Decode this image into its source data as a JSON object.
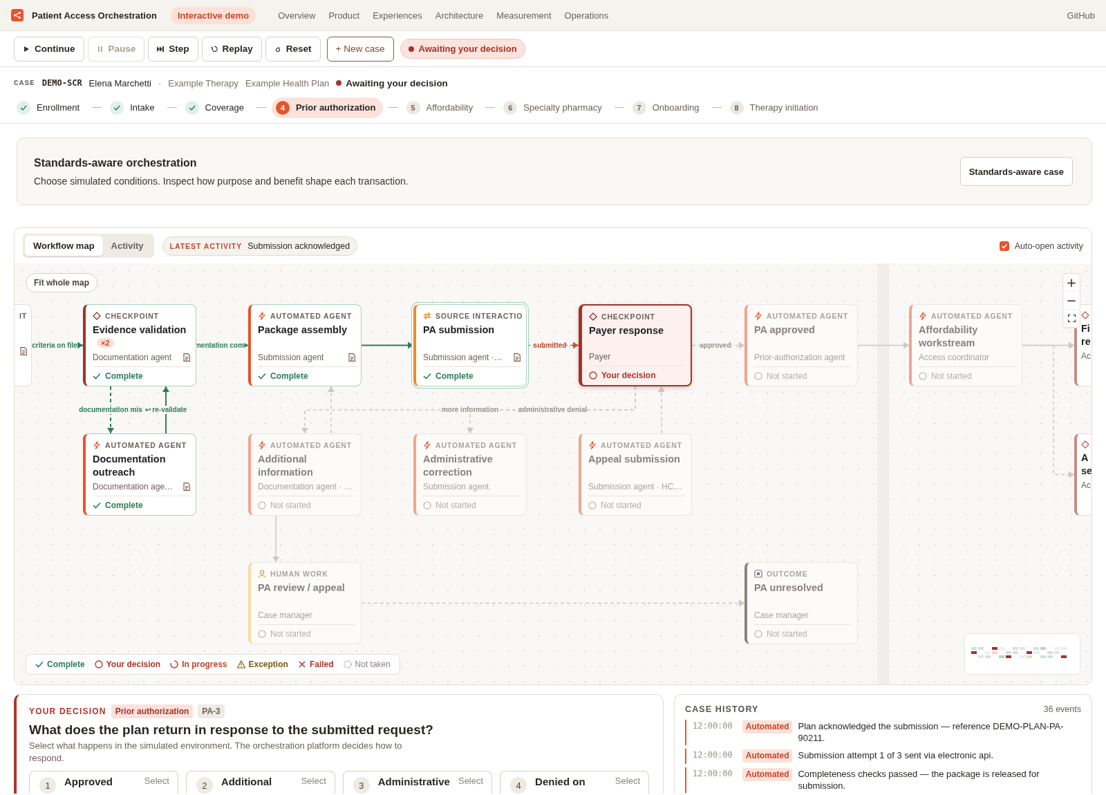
{
  "nav": {
    "title": "Patient Access Orchestration",
    "badge": "Interactive demo",
    "links": [
      "Overview",
      "Product",
      "Experiences",
      "Architecture",
      "Measurement",
      "Operations"
    ],
    "github": "GitHub"
  },
  "toolbar": {
    "buttons": [
      {
        "kind": "play",
        "label": "Continue",
        "disabled": false
      },
      {
        "kind": "pause",
        "label": "Pause",
        "disabled": true
      },
      {
        "kind": "step",
        "label": "Step",
        "disabled": false
      },
      {
        "kind": "replay",
        "label": "Replay",
        "disabled": false
      },
      {
        "kind": "reset",
        "label": "Reset",
        "disabled": false
      },
      {
        "kind": "new",
        "label": "+ New case",
        "disabled": false
      }
    ],
    "status": "Awaiting your decision"
  },
  "case": {
    "label": "CASE",
    "id": "DEMO-SCR",
    "patient": "Elena Marchetti",
    "separator": "·",
    "therapy": "Example Therapy",
    "plan": "Example Health Plan",
    "status": "Awaiting your decision"
  },
  "steps": [
    {
      "label": "Enrollment",
      "completed": true,
      "selected": false
    },
    {
      "label": "Intake",
      "completed": true,
      "selected": false
    },
    {
      "label": "Coverage",
      "completed": true,
      "selected": false
    },
    {
      "number": "4",
      "label": "Prior authorization",
      "completed": false,
      "selected": true
    },
    {
      "number": "5",
      "label": "Affordability",
      "completed": false,
      "selected": false
    },
    {
      "number": "6",
      "label": "Specialty pharmacy",
      "completed": false,
      "selected": false
    },
    {
      "number": "7",
      "label": "Onboarding",
      "completed": false,
      "selected": false
    },
    {
      "number": "8",
      "label": "Therapy initiation",
      "completed": false,
      "selected": false
    }
  ],
  "banner": {
    "title": "Standards-aware orchestration",
    "text": "Choose simulated conditions. Inspect how purpose and benefit shape each transaction.",
    "button": "Standards-aware case"
  },
  "map": {
    "tabs": [
      {
        "label": "Workflow map",
        "selected": true
      },
      {
        "label": "Activity",
        "selected": false
      }
    ],
    "latest": {
      "label": "LATEST ACTIVITY",
      "text": "Submission acknowledged"
    },
    "auto_open": {
      "label": "Auto-open activity",
      "checked": true
    },
    "fit_button": "Fit whole map",
    "zoom_controls": [
      "+",
      "−"
    ],
    "nodes": [
      {
        "kind": "partial",
        "label": "IT",
        "doc": true
      },
      {
        "kind": "checkpoint",
        "label": "CHECKPOINT",
        "title": "Evidence validation",
        "badge": "×2",
        "role": "Documentation agent",
        "doc": true,
        "complete": true,
        "awaiting_decision": false,
        "status_text": "Complete",
        "selected": false,
        "focused": false
      },
      {
        "kind": "agent",
        "label": "AUTOMATED AGENT",
        "title": "Package assembly",
        "role": "Submission agent",
        "doc": true,
        "complete": true,
        "awaiting_decision": false,
        "status_text": "Complete",
        "selected": false,
        "focused": false
      },
      {
        "kind": "source",
        "label": "SOURCE INTERACTIO",
        "title": "PA submission",
        "role": "Submission agent ·…",
        "doc": true,
        "complete": true,
        "awaiting_decision": false,
        "status_text": "Complete",
        "selected": false,
        "focused": true
      },
      {
        "kind": "checkpoint",
        "label": "CHECKPOINT",
        "title": "Payer response",
        "role": "Payer",
        "doc": false,
        "complete": false,
        "awaiting_decision": true,
        "status_text": "Your decision",
        "selected": true,
        "focused": false
      },
      {
        "kind": "agent",
        "label": "AUTOMATED AGENT",
        "title": "PA approved",
        "role": "Prior-authorization agent",
        "doc": false,
        "complete": false,
        "awaiting_decision": false,
        "status_text": "Not started",
        "selected": false,
        "focused": false
      },
      {
        "kind": "agent",
        "label": "AUTOMATED AGENT",
        "title": "Affordability workstream",
        "role": "Access coordinator",
        "doc": false,
        "complete": false,
        "awaiting_decision": false,
        "status_text": "Not started",
        "selected": false,
        "focused": false
      },
      {
        "kind": "partial",
        "title": "Fi re",
        "role": "Ac"
      },
      {
        "kind": "agent",
        "label": "AUTOMATED AGENT",
        "title": "Documentation outreach",
        "role": "Documentation age…",
        "doc": true,
        "complete": true,
        "awaiting_decision": false,
        "status_text": "Complete",
        "selected": false,
        "focused": false
      },
      {
        "kind": "agent",
        "label": "AUTOMATED AGENT",
        "title": "Additional information",
        "role": "Documentation agent · …",
        "doc": false,
        "complete": false,
        "awaiting_decision": false,
        "status_text": "Not started",
        "selected": false,
        "focused": false
      },
      {
        "kind": "agent",
        "label": "AUTOMATED AGENT",
        "title": "Administrative correction",
        "role": "Submission agent",
        "doc": false,
        "complete": false,
        "awaiting_decision": false,
        "status_text": "Not started",
        "selected": false,
        "focused": false
      },
      {
        "kind": "agent",
        "label": "AUTOMATED AGENT",
        "title": "Appeal submission",
        "role": "Submission agent · HC…",
        "doc": false,
        "complete": false,
        "awaiting_decision": false,
        "status_text": "Not started",
        "selected": false,
        "focused": false
      },
      {
        "kind": "partial",
        "title": "A se",
        "role": "Ac"
      },
      {
        "kind": "human",
        "label": "HUMAN WORK",
        "title": "PA review / appeal",
        "role": "Case manager",
        "doc": false,
        "complete": false,
        "awaiting_decision": false,
        "status_text": "Not started",
        "selected": false,
        "focused": false
      },
      {
        "kind": "outcome",
        "label": "OUTCOME",
        "title": "PA unresolved",
        "role": "Case manager",
        "doc": false,
        "complete": false,
        "awaiting_decision": false,
        "status_text": "Not started",
        "selected": false,
        "focused": false
      }
    ],
    "edges": [
      {
        "kind": "done",
        "label": "criteria on file"
      },
      {
        "kind": "done",
        "label": "mentation com"
      },
      {
        "kind": "done",
        "dashed": false
      },
      {
        "kind": "active",
        "label": "submitted",
        "dashed": true
      },
      {
        "kind": "pending",
        "label": "approved",
        "dashed": true
      },
      {
        "kind": "pending",
        "dashed": false
      },
      {
        "kind": "pending",
        "dashed": false
      },
      {
        "kind": "done",
        "label": "documentation mis",
        "dashed": true
      },
      {
        "kind": "done",
        "label": "↩ re-validate",
        "dashed": false
      },
      {
        "kind": "pending",
        "label": "more information",
        "dashed": true
      },
      {
        "kind": "pending",
        "label": "administrative denial",
        "dashed": true
      },
      {
        "kind": "pending",
        "dashed": false
      },
      {
        "kind": "pending",
        "dashed": true
      },
      {
        "kind": "pending",
        "dashed": true
      },
      {
        "kind": "pending",
        "dashed": true
      },
      {
        "kind": "pending",
        "dashed": true
      }
    ],
    "legend": [
      {
        "kind": "complete",
        "label": "Complete"
      },
      {
        "kind": "decision",
        "label": "Your decision"
      },
      {
        "kind": "progress",
        "label": "In progress"
      },
      {
        "kind": "exception",
        "label": "Exception"
      },
      {
        "kind": "failed",
        "label": "Failed"
      },
      {
        "kind": "not_taken",
        "label": "Not taken"
      }
    ]
  },
  "decision": {
    "label": "YOUR DECISION",
    "tags": [
      "Prior authorization",
      "PA-3"
    ],
    "question": "What does the plan return in response to the submitted request?",
    "text": "Select what happens in the simulated environment. The orchestration platform decides how to respond.",
    "options": [
      {
        "number": "1",
        "title": "Approved",
        "action": "Select"
      },
      {
        "number": "2",
        "title": "Additional",
        "action": "Select"
      },
      {
        "number": "3",
        "title": "Administrative",
        "action": "Select"
      },
      {
        "number": "4",
        "title": "Denied on",
        "action": "Select"
      }
    ]
  },
  "history": {
    "title": "CASE HISTORY",
    "count": "36 events",
    "entries": [
      {
        "time": "12:00:00",
        "tag": "Automated",
        "text": "Plan acknowledged the submission — reference DEMO-PLAN-PA-90211."
      },
      {
        "time": "12:00:00",
        "tag": "Automated",
        "text": "Submission attempt 1 of 3 sent via electronic api."
      },
      {
        "time": "12:00:00",
        "tag": "Automated",
        "text": "Completeness checks passed — the package is released for submission."
      }
    ]
  }
}
